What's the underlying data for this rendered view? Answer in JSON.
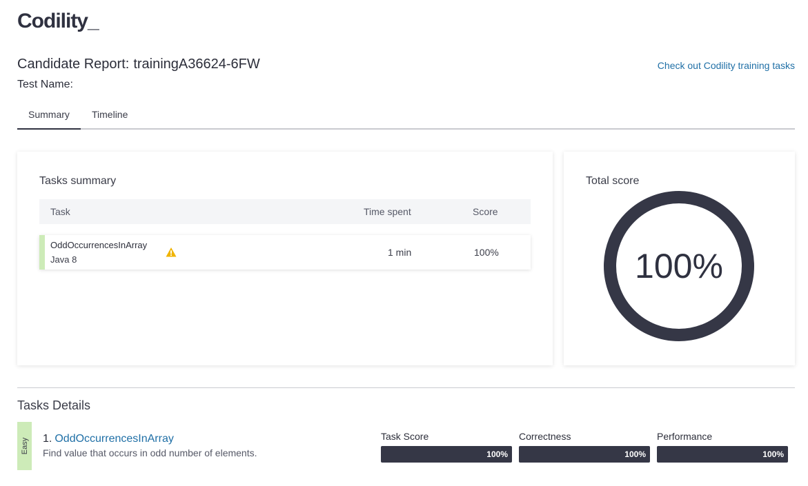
{
  "logo": {
    "text": "Codility",
    "cursor": "_"
  },
  "report": {
    "title_prefix": "Candidate Report:",
    "candidate_id": "trainingA36624-6FW",
    "test_name_label": "Test Name:",
    "training_link": "Check out Codility training tasks"
  },
  "tabs": [
    {
      "label": "Summary",
      "active": true
    },
    {
      "label": "Timeline",
      "active": false
    }
  ],
  "summary": {
    "title": "Tasks summary",
    "columns": {
      "task": "Task",
      "time": "Time spent",
      "score": "Score"
    },
    "rows": [
      {
        "name": "OddOccurrencesInArray",
        "language": "Java 8",
        "icon": "warning-icon",
        "time": "1 min",
        "score": "100%"
      }
    ]
  },
  "total": {
    "title": "Total score",
    "value": "100%",
    "fraction": 1.0,
    "ring_color": "#353746"
  },
  "details": {
    "title": "Tasks Details",
    "tasks": [
      {
        "difficulty": "Easy",
        "number": "1.",
        "name": "OddOccurrencesInArray",
        "description": "Find value that occurs in odd number of elements.",
        "metrics": [
          {
            "label": "Task Score",
            "value": "100%",
            "fraction": 1.0
          },
          {
            "label": "Correctness",
            "value": "100%",
            "fraction": 1.0
          },
          {
            "label": "Performance",
            "value": "100%",
            "fraction": 1.0
          }
        ]
      }
    ]
  },
  "colors": {
    "accent_link": "#1f6fa6",
    "difficulty_easy": "#cdebb8",
    "warning": "#f0b400"
  }
}
